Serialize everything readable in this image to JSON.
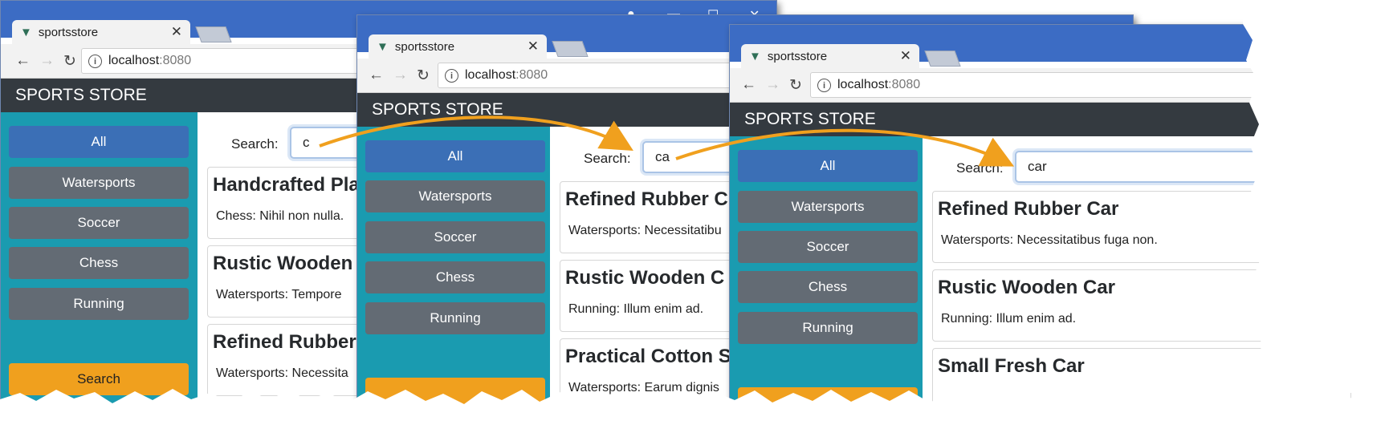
{
  "colors": {
    "titlebar": "#3c6cc4",
    "storebar": "#343a40",
    "sidebar": "#1a9bb0",
    "category_active": "#3b6fb6",
    "category_inactive": "#636b74",
    "search_button": "#f0a01e",
    "annotation_arrow": "#f0a01e"
  },
  "windows": [
    {
      "tab": {
        "title": "sportsstore",
        "icon": "vue-logo-icon",
        "close": "✕"
      },
      "toolbar": {
        "back": "←",
        "forward": "→",
        "reload": "↻",
        "url_host": "localhost",
        "url_port": ":8080"
      },
      "store": {
        "title": "SPORTS STORE"
      },
      "categories": [
        {
          "label": "All",
          "active": true
        },
        {
          "label": "Watersports",
          "active": false
        },
        {
          "label": "Soccer",
          "active": false
        },
        {
          "label": "Chess",
          "active": false
        },
        {
          "label": "Running",
          "active": false
        }
      ],
      "search_button": "Search",
      "search": {
        "label": "Search:",
        "value": "c"
      },
      "products": [
        {
          "name": "Handcrafted Pla",
          "desc": "Chess: Nihil non nulla."
        },
        {
          "name": "Rustic Wooden",
          "desc": "Watersports: Tempore"
        },
        {
          "name": "Refined Rubber",
          "desc": "Watersports: Necessita"
        }
      ]
    },
    {
      "tab": {
        "title": "sportsstore",
        "icon": "vue-logo-icon",
        "close": "✕"
      },
      "toolbar": {
        "back": "←",
        "forward": "→",
        "reload": "↻",
        "url_host": "localhost",
        "url_port": ":8080"
      },
      "store": {
        "title": "SPORTS STORE"
      },
      "categories": [
        {
          "label": "All",
          "active": true
        },
        {
          "label": "Watersports",
          "active": false
        },
        {
          "label": "Soccer",
          "active": false
        },
        {
          "label": "Chess",
          "active": false
        },
        {
          "label": "Running",
          "active": false
        }
      ],
      "search_button": "",
      "search": {
        "label": "Search:",
        "value": "ca"
      },
      "products": [
        {
          "name": "Refined Rubber C",
          "desc": "Watersports: Necessitatibu"
        },
        {
          "name": "Rustic Wooden C",
          "desc": "Running: Illum enim ad."
        },
        {
          "name": "Practical Cotton S",
          "desc": "Watersports: Earum dignis"
        }
      ]
    },
    {
      "tab": {
        "title": "sportsstore",
        "icon": "vue-logo-icon",
        "close": "✕"
      },
      "toolbar": {
        "back": "←",
        "forward": "→",
        "reload": "↻",
        "url_host": "localhost",
        "url_port": ":8080"
      },
      "store": {
        "title": "SPORTS STORE"
      },
      "categories": [
        {
          "label": "All",
          "active": true
        },
        {
          "label": "Watersports",
          "active": false
        },
        {
          "label": "Soccer",
          "active": false
        },
        {
          "label": "Chess",
          "active": false
        },
        {
          "label": "Running",
          "active": false
        }
      ],
      "search_button": "",
      "search": {
        "label": "Search:",
        "value": "car"
      },
      "products": [
        {
          "name": "Refined Rubber Car",
          "desc": "Watersports: Necessitatibus fuga non."
        },
        {
          "name": "Rustic Wooden Car",
          "desc": "Running: Illum enim ad."
        },
        {
          "name": "Small Fresh Car",
          "desc": ""
        }
      ]
    }
  ]
}
